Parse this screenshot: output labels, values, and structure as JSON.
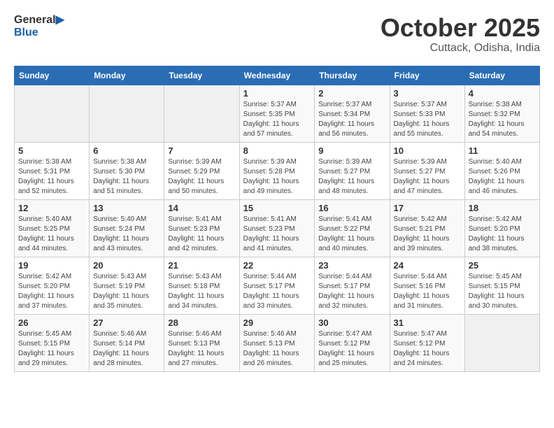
{
  "header": {
    "logo_general": "General",
    "logo_blue": "Blue",
    "month": "October 2025",
    "location": "Cuttack, Odisha, India"
  },
  "days_of_week": [
    "Sunday",
    "Monday",
    "Tuesday",
    "Wednesday",
    "Thursday",
    "Friday",
    "Saturday"
  ],
  "weeks": [
    [
      {
        "day": "",
        "info": ""
      },
      {
        "day": "",
        "info": ""
      },
      {
        "day": "",
        "info": ""
      },
      {
        "day": "1",
        "info": "Sunrise: 5:37 AM\nSunset: 5:35 PM\nDaylight: 11 hours\nand 57 minutes."
      },
      {
        "day": "2",
        "info": "Sunrise: 5:37 AM\nSunset: 5:34 PM\nDaylight: 11 hours\nand 56 minutes."
      },
      {
        "day": "3",
        "info": "Sunrise: 5:37 AM\nSunset: 5:33 PM\nDaylight: 11 hours\nand 55 minutes."
      },
      {
        "day": "4",
        "info": "Sunrise: 5:38 AM\nSunset: 5:32 PM\nDaylight: 11 hours\nand 54 minutes."
      }
    ],
    [
      {
        "day": "5",
        "info": "Sunrise: 5:38 AM\nSunset: 5:31 PM\nDaylight: 11 hours\nand 52 minutes."
      },
      {
        "day": "6",
        "info": "Sunrise: 5:38 AM\nSunset: 5:30 PM\nDaylight: 11 hours\nand 51 minutes."
      },
      {
        "day": "7",
        "info": "Sunrise: 5:39 AM\nSunset: 5:29 PM\nDaylight: 11 hours\nand 50 minutes."
      },
      {
        "day": "8",
        "info": "Sunrise: 5:39 AM\nSunset: 5:28 PM\nDaylight: 11 hours\nand 49 minutes."
      },
      {
        "day": "9",
        "info": "Sunrise: 5:39 AM\nSunset: 5:27 PM\nDaylight: 11 hours\nand 48 minutes."
      },
      {
        "day": "10",
        "info": "Sunrise: 5:39 AM\nSunset: 5:27 PM\nDaylight: 11 hours\nand 47 minutes."
      },
      {
        "day": "11",
        "info": "Sunrise: 5:40 AM\nSunset: 5:26 PM\nDaylight: 11 hours\nand 46 minutes."
      }
    ],
    [
      {
        "day": "12",
        "info": "Sunrise: 5:40 AM\nSunset: 5:25 PM\nDaylight: 11 hours\nand 44 minutes."
      },
      {
        "day": "13",
        "info": "Sunrise: 5:40 AM\nSunset: 5:24 PM\nDaylight: 11 hours\nand 43 minutes."
      },
      {
        "day": "14",
        "info": "Sunrise: 5:41 AM\nSunset: 5:23 PM\nDaylight: 11 hours\nand 42 minutes."
      },
      {
        "day": "15",
        "info": "Sunrise: 5:41 AM\nSunset: 5:23 PM\nDaylight: 11 hours\nand 41 minutes."
      },
      {
        "day": "16",
        "info": "Sunrise: 5:41 AM\nSunset: 5:22 PM\nDaylight: 11 hours\nand 40 minutes."
      },
      {
        "day": "17",
        "info": "Sunrise: 5:42 AM\nSunset: 5:21 PM\nDaylight: 11 hours\nand 39 minutes."
      },
      {
        "day": "18",
        "info": "Sunrise: 5:42 AM\nSunset: 5:20 PM\nDaylight: 11 hours\nand 38 minutes."
      }
    ],
    [
      {
        "day": "19",
        "info": "Sunrise: 5:42 AM\nSunset: 5:20 PM\nDaylight: 11 hours\nand 37 minutes."
      },
      {
        "day": "20",
        "info": "Sunrise: 5:43 AM\nSunset: 5:19 PM\nDaylight: 11 hours\nand 35 minutes."
      },
      {
        "day": "21",
        "info": "Sunrise: 5:43 AM\nSunset: 5:18 PM\nDaylight: 11 hours\nand 34 minutes."
      },
      {
        "day": "22",
        "info": "Sunrise: 5:44 AM\nSunset: 5:17 PM\nDaylight: 11 hours\nand 33 minutes."
      },
      {
        "day": "23",
        "info": "Sunrise: 5:44 AM\nSunset: 5:17 PM\nDaylight: 11 hours\nand 32 minutes."
      },
      {
        "day": "24",
        "info": "Sunrise: 5:44 AM\nSunset: 5:16 PM\nDaylight: 11 hours\nand 31 minutes."
      },
      {
        "day": "25",
        "info": "Sunrise: 5:45 AM\nSunset: 5:15 PM\nDaylight: 11 hours\nand 30 minutes."
      }
    ],
    [
      {
        "day": "26",
        "info": "Sunrise: 5:45 AM\nSunset: 5:15 PM\nDaylight: 11 hours\nand 29 minutes."
      },
      {
        "day": "27",
        "info": "Sunrise: 5:46 AM\nSunset: 5:14 PM\nDaylight: 11 hours\nand 28 minutes."
      },
      {
        "day": "28",
        "info": "Sunrise: 5:46 AM\nSunset: 5:13 PM\nDaylight: 11 hours\nand 27 minutes."
      },
      {
        "day": "29",
        "info": "Sunrise: 5:46 AM\nSunset: 5:13 PM\nDaylight: 11 hours\nand 26 minutes."
      },
      {
        "day": "30",
        "info": "Sunrise: 5:47 AM\nSunset: 5:12 PM\nDaylight: 11 hours\nand 25 minutes."
      },
      {
        "day": "31",
        "info": "Sunrise: 5:47 AM\nSunset: 5:12 PM\nDaylight: 11 hours\nand 24 minutes."
      },
      {
        "day": "",
        "info": ""
      }
    ]
  ]
}
